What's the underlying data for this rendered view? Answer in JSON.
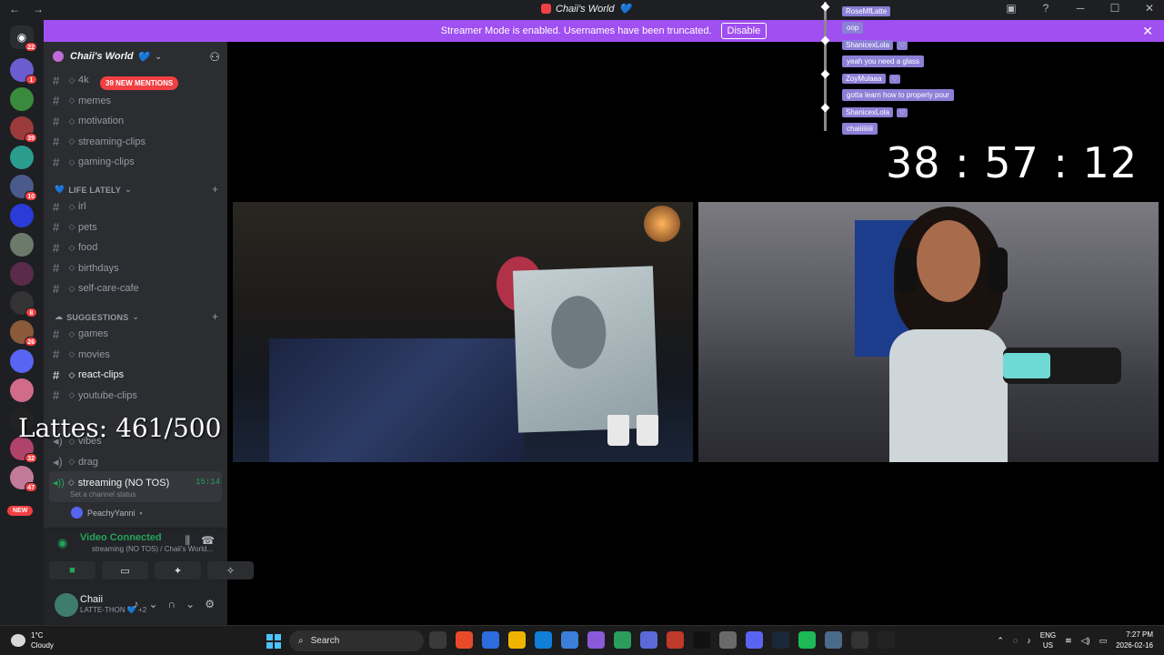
{
  "titlebar": {
    "title": "Chaii's World",
    "heart": "💙",
    "back": "←",
    "forward": "→",
    "inbox_icon": "inbox-icon",
    "help": "?",
    "minimize": "─",
    "maximize": "☐",
    "close": "✕"
  },
  "banner": {
    "text": "Streamer Mode is enabled. Usernames have been truncated.",
    "disable_label": "Disable",
    "close": "✕"
  },
  "rail": {
    "home_badge": "22",
    "servers": [
      {
        "badge": "1",
        "color": "#6d5bd0"
      },
      {
        "badge": "",
        "color": "#3a8a3e"
      },
      {
        "badge": "39",
        "color": "#9b3b3b"
      },
      {
        "badge": "",
        "color": "#2a9d8f"
      },
      {
        "badge": "10",
        "color": "#4a5a8a"
      },
      {
        "badge": "",
        "color": "#2b3bd8"
      },
      {
        "badge": "",
        "color": "#6c7a6c"
      },
      {
        "badge": "",
        "color": "#5a2b4a"
      },
      {
        "badge": "8",
        "color": "#333333"
      },
      {
        "badge": "26",
        "color": "#8a5a3a"
      },
      {
        "badge": "",
        "color": "#5865f2"
      },
      {
        "badge": "",
        "color": "#d06b8a"
      },
      {
        "badge": "",
        "color": "#222222"
      },
      {
        "badge": "32",
        "color": "#b0436a"
      },
      {
        "badge": "47",
        "color": "#c27a9a"
      }
    ],
    "new_label": "NEW"
  },
  "guild": {
    "name": "Chaii's World",
    "heart": "💙",
    "chevron": "⌄",
    "invite_icon": "add-member-icon",
    "mentions": "39 NEW MENTIONS"
  },
  "channels_top": [
    {
      "name": "4k"
    },
    {
      "name": "memes"
    },
    {
      "name": "motivation"
    },
    {
      "name": "streaming-clips"
    },
    {
      "name": "gaming-clips"
    }
  ],
  "category_life": {
    "label": "LIFE LATELY",
    "emoji": "💙"
  },
  "channels_life": [
    {
      "name": "irl"
    },
    {
      "name": "pets"
    },
    {
      "name": "food"
    },
    {
      "name": "birthdays"
    },
    {
      "name": "self-care-cafe"
    }
  ],
  "category_suggest": {
    "label": "SUGGESTIONS",
    "emoji": "☁"
  },
  "channels_suggest": [
    {
      "name": "games"
    },
    {
      "name": "movies"
    },
    {
      "name": "react-clips"
    },
    {
      "name": "youtube-clips"
    }
  ],
  "voice_channels": [
    {
      "name": "vibes"
    },
    {
      "name": "drag"
    }
  ],
  "active_voice": {
    "name": "streaming (NO TOS)",
    "time": "15:14",
    "status": "Set a channel status",
    "member": "PeachyYanni"
  },
  "overlay": {
    "lattes": "Lattes: 461/500",
    "timer": "38 : 57 : 12"
  },
  "voice_panel": {
    "title": "Video Connected",
    "sub": "streaming (NO TOS) / Chaii's World..."
  },
  "user_panel": {
    "name": "Chaii",
    "sub": "LATTE-THON 💙 +2"
  },
  "chat": [
    {
      "user": "RoseMfLatte",
      "tag": "",
      "text": "oop"
    },
    {
      "user": "ShanicexLola",
      "tag": "♡",
      "text": "yeah you need a glass"
    },
    {
      "user": "ZoyMulaaa",
      "tag": "♡",
      "text": "gotta learn how to properly pour"
    },
    {
      "user": "ShanicexLola",
      "tag": "♡",
      "text": "chaiiiiiiiii"
    }
  ],
  "taskbar": {
    "temp": "1°C",
    "weather": "Cloudy",
    "search_placeholder": "Search",
    "lang_top": "ENG",
    "lang_bottom": "US",
    "time": "7:27 PM",
    "date": "2026-02-16",
    "apps": [
      "#3a3a3a",
      "#e84a2a",
      "#2b6cde",
      "#f0b400",
      "#0f7fd8",
      "#3b7fd8",
      "#8a5ad8",
      "#2a9d5a",
      "#5a6ad8",
      "#c0392b",
      "#111111",
      "#6a6a6a",
      "#5865f2",
      "#1b2838",
      "#1db954",
      "#4a6a8a",
      "#333333",
      "#222222"
    ]
  }
}
